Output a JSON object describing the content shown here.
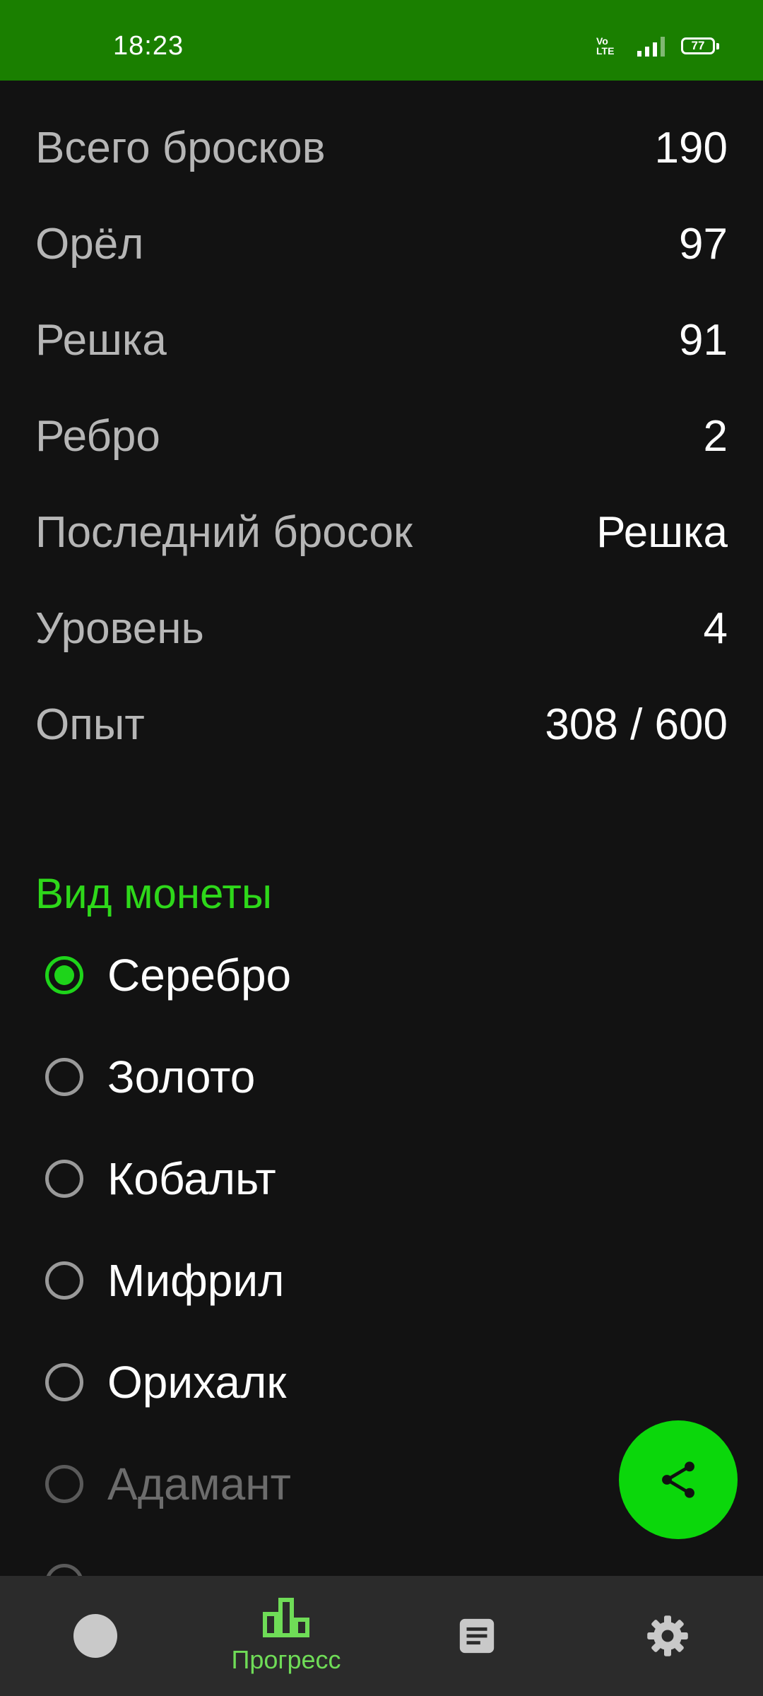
{
  "status_bar": {
    "time": "18:23",
    "network_label_top": "Vo",
    "network_label_bottom": "LTE",
    "battery": "77"
  },
  "stats": [
    {
      "label": "Всего бросков",
      "value": "190"
    },
    {
      "label": "Орёл",
      "value": "97"
    },
    {
      "label": "Решка",
      "value": "91"
    },
    {
      "label": "Ребро",
      "value": "2"
    },
    {
      "label": "Последний бросок",
      "value": "Решка"
    },
    {
      "label": "Уровень",
      "value": "4"
    },
    {
      "label": "Опыт",
      "value": "308 / 600"
    }
  ],
  "coin_type": {
    "title": "Вид монеты",
    "selected": "Серебро",
    "options": [
      "Серебро",
      "Золото",
      "Кобальт",
      "Мифрил",
      "Орихалк",
      "Адамант"
    ]
  },
  "fab": {
    "icon": "share-icon"
  },
  "bottom_nav": {
    "items": [
      {
        "icon": "coin-icon",
        "label": ""
      },
      {
        "icon": "bar-chart-icon",
        "label": "Прогресс"
      },
      {
        "icon": "document-icon",
        "label": ""
      },
      {
        "icon": "gear-icon",
        "label": ""
      }
    ],
    "active": "Прогресс"
  },
  "colors": {
    "status_bar": "#1a7f00",
    "accent": "#1ed41a",
    "background": "#121212",
    "nav_background": "#2b2b2b",
    "fab": "#0bd70b"
  }
}
